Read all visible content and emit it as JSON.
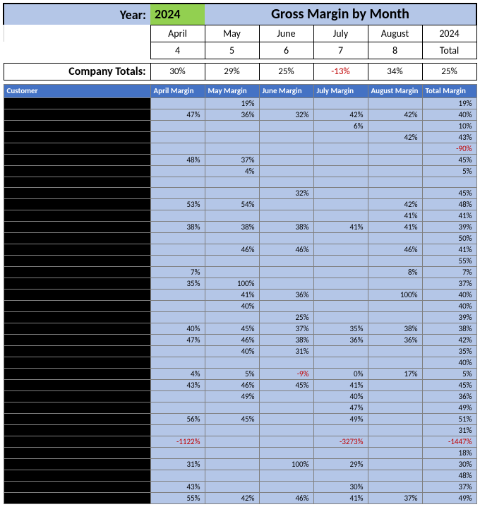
{
  "header": {
    "year_label": "Year:",
    "year_value": "2024",
    "title": "Gross Margin by Month",
    "months": [
      "April",
      "May",
      "June",
      "July",
      "August"
    ],
    "month_nums": [
      "4",
      "5",
      "6",
      "7",
      "8"
    ],
    "year_col_label": "2024",
    "total_label": "Total",
    "company_label": "Company Totals:",
    "company_vals": [
      "30%",
      "29%",
      "25%",
      "-13%",
      "34%",
      "25%"
    ]
  },
  "data_header": {
    "customer": "Customer",
    "cols": [
      "April Margin",
      "May Margin",
      "June Margin",
      "July Margin",
      "August Margin",
      "Total Margin"
    ]
  },
  "rows": [
    {
      "c": "",
      "v": [
        "",
        "19%",
        "",
        "",
        "",
        "19%"
      ]
    },
    {
      "c": "",
      "v": [
        "47%",
        "36%",
        "32%",
        "42%",
        "42%",
        "40%"
      ]
    },
    {
      "c": "",
      "v": [
        "",
        "",
        "",
        "6%",
        "",
        "10%"
      ]
    },
    {
      "c": "",
      "v": [
        "",
        "",
        "",
        "",
        "42%",
        "43%"
      ]
    },
    {
      "c": "",
      "v": [
        "",
        "",
        "",
        "",
        "",
        "-90%"
      ]
    },
    {
      "c": "",
      "v": [
        "48%",
        "37%",
        "",
        "",
        "",
        "45%"
      ]
    },
    {
      "c": "",
      "v": [
        "",
        "4%",
        "",
        "",
        "",
        "5%"
      ]
    },
    {
      "c": "",
      "v": [
        "",
        "",
        "",
        "",
        "",
        ""
      ]
    },
    {
      "c": "",
      "v": [
        "",
        "",
        "32%",
        "",
        "",
        "45%"
      ]
    },
    {
      "c": "",
      "v": [
        "53%",
        "54%",
        "",
        "",
        "42%",
        "48%"
      ]
    },
    {
      "c": "",
      "v": [
        "",
        "",
        "",
        "",
        "41%",
        "41%"
      ]
    },
    {
      "c": "",
      "v": [
        "38%",
        "38%",
        "38%",
        "41%",
        "41%",
        "39%"
      ]
    },
    {
      "c": "",
      "v": [
        "",
        "",
        "",
        "",
        "",
        "50%"
      ]
    },
    {
      "c": "",
      "v": [
        "",
        "46%",
        "46%",
        "",
        "46%",
        "41%"
      ]
    },
    {
      "c": "",
      "v": [
        "",
        "",
        "",
        "",
        "",
        "55%"
      ]
    },
    {
      "c": "",
      "v": [
        "7%",
        "",
        "",
        "",
        "8%",
        "7%"
      ]
    },
    {
      "c": "",
      "v": [
        "35%",
        "100%",
        "",
        "",
        "",
        "37%"
      ]
    },
    {
      "c": "",
      "v": [
        "",
        "41%",
        "36%",
        "",
        "100%",
        "40%"
      ]
    },
    {
      "c": "",
      "v": [
        "",
        "40%",
        "",
        "",
        "",
        "40%"
      ]
    },
    {
      "c": "",
      "v": [
        "",
        "",
        "25%",
        "",
        "",
        "39%"
      ]
    },
    {
      "c": "",
      "v": [
        "40%",
        "45%",
        "37%",
        "35%",
        "38%",
        "38%"
      ]
    },
    {
      "c": "",
      "v": [
        "47%",
        "46%",
        "38%",
        "36%",
        "36%",
        "42%"
      ]
    },
    {
      "c": "",
      "v": [
        "",
        "40%",
        "31%",
        "",
        "",
        "35%"
      ]
    },
    {
      "c": "",
      "v": [
        "",
        "",
        "",
        "",
        "",
        "40%"
      ]
    },
    {
      "c": "",
      "v": [
        "4%",
        "5%",
        "-9%",
        "0%",
        "17%",
        "5%"
      ]
    },
    {
      "c": "",
      "v": [
        "43%",
        "46%",
        "45%",
        "41%",
        "",
        "45%"
      ]
    },
    {
      "c": "",
      "v": [
        "",
        "49%",
        "",
        "40%",
        "",
        "36%"
      ]
    },
    {
      "c": "",
      "v": [
        "",
        "",
        "",
        "47%",
        "",
        "49%"
      ]
    },
    {
      "c": "",
      "v": [
        "56%",
        "45%",
        "",
        "49%",
        "",
        "51%"
      ]
    },
    {
      "c": "",
      "v": [
        "",
        "",
        "",
        "",
        "",
        "31%"
      ]
    },
    {
      "c": "",
      "v": [
        "-1122%",
        "",
        "",
        "-3273%",
        "",
        "-1447%"
      ]
    },
    {
      "c": "",
      "v": [
        "",
        "",
        "",
        "",
        "",
        "18%"
      ]
    },
    {
      "c": "",
      "v": [
        "31%",
        "",
        "100%",
        "29%",
        "",
        "30%"
      ]
    },
    {
      "c": "",
      "v": [
        "",
        "",
        "",
        "",
        "",
        "48%"
      ]
    },
    {
      "c": "",
      "v": [
        "43%",
        "",
        "",
        "30%",
        "",
        "37%"
      ]
    },
    {
      "c": "",
      "v": [
        "55%",
        "42%",
        "46%",
        "41%",
        "37%",
        "49%"
      ]
    }
  ]
}
